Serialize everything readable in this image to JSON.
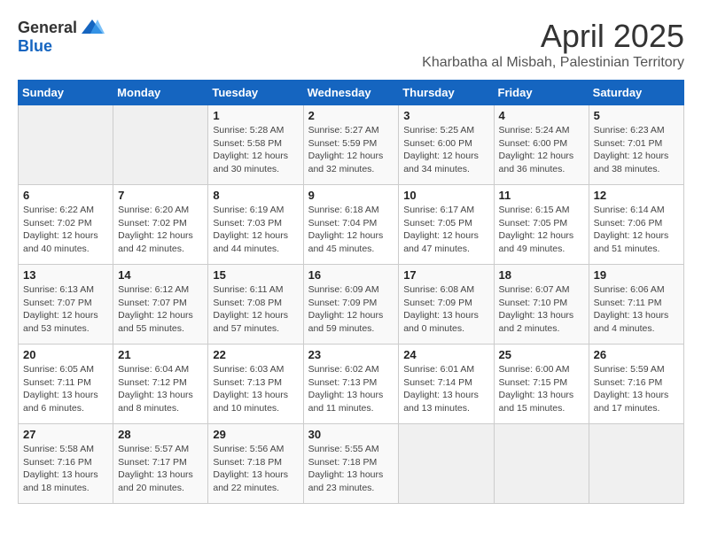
{
  "header": {
    "logo_general": "General",
    "logo_blue": "Blue",
    "month_title": "April 2025",
    "location": "Kharbatha al Misbah, Palestinian Territory"
  },
  "days_of_week": [
    "Sunday",
    "Monday",
    "Tuesday",
    "Wednesday",
    "Thursday",
    "Friday",
    "Saturday"
  ],
  "weeks": [
    [
      {
        "day": "",
        "info": ""
      },
      {
        "day": "",
        "info": ""
      },
      {
        "day": "1",
        "info": "Sunrise: 5:28 AM\nSunset: 5:58 PM\nDaylight: 12 hours\nand 30 minutes."
      },
      {
        "day": "2",
        "info": "Sunrise: 5:27 AM\nSunset: 5:59 PM\nDaylight: 12 hours\nand 32 minutes."
      },
      {
        "day": "3",
        "info": "Sunrise: 5:25 AM\nSunset: 6:00 PM\nDaylight: 12 hours\nand 34 minutes."
      },
      {
        "day": "4",
        "info": "Sunrise: 5:24 AM\nSunset: 6:00 PM\nDaylight: 12 hours\nand 36 minutes."
      },
      {
        "day": "5",
        "info": "Sunrise: 6:23 AM\nSunset: 7:01 PM\nDaylight: 12 hours\nand 38 minutes."
      }
    ],
    [
      {
        "day": "6",
        "info": "Sunrise: 6:22 AM\nSunset: 7:02 PM\nDaylight: 12 hours\nand 40 minutes."
      },
      {
        "day": "7",
        "info": "Sunrise: 6:20 AM\nSunset: 7:02 PM\nDaylight: 12 hours\nand 42 minutes."
      },
      {
        "day": "8",
        "info": "Sunrise: 6:19 AM\nSunset: 7:03 PM\nDaylight: 12 hours\nand 44 minutes."
      },
      {
        "day": "9",
        "info": "Sunrise: 6:18 AM\nSunset: 7:04 PM\nDaylight: 12 hours\nand 45 minutes."
      },
      {
        "day": "10",
        "info": "Sunrise: 6:17 AM\nSunset: 7:05 PM\nDaylight: 12 hours\nand 47 minutes."
      },
      {
        "day": "11",
        "info": "Sunrise: 6:15 AM\nSunset: 7:05 PM\nDaylight: 12 hours\nand 49 minutes."
      },
      {
        "day": "12",
        "info": "Sunrise: 6:14 AM\nSunset: 7:06 PM\nDaylight: 12 hours\nand 51 minutes."
      }
    ],
    [
      {
        "day": "13",
        "info": "Sunrise: 6:13 AM\nSunset: 7:07 PM\nDaylight: 12 hours\nand 53 minutes."
      },
      {
        "day": "14",
        "info": "Sunrise: 6:12 AM\nSunset: 7:07 PM\nDaylight: 12 hours\nand 55 minutes."
      },
      {
        "day": "15",
        "info": "Sunrise: 6:11 AM\nSunset: 7:08 PM\nDaylight: 12 hours\nand 57 minutes."
      },
      {
        "day": "16",
        "info": "Sunrise: 6:09 AM\nSunset: 7:09 PM\nDaylight: 12 hours\nand 59 minutes."
      },
      {
        "day": "17",
        "info": "Sunrise: 6:08 AM\nSunset: 7:09 PM\nDaylight: 13 hours\nand 0 minutes."
      },
      {
        "day": "18",
        "info": "Sunrise: 6:07 AM\nSunset: 7:10 PM\nDaylight: 13 hours\nand 2 minutes."
      },
      {
        "day": "19",
        "info": "Sunrise: 6:06 AM\nSunset: 7:11 PM\nDaylight: 13 hours\nand 4 minutes."
      }
    ],
    [
      {
        "day": "20",
        "info": "Sunrise: 6:05 AM\nSunset: 7:11 PM\nDaylight: 13 hours\nand 6 minutes."
      },
      {
        "day": "21",
        "info": "Sunrise: 6:04 AM\nSunset: 7:12 PM\nDaylight: 13 hours\nand 8 minutes."
      },
      {
        "day": "22",
        "info": "Sunrise: 6:03 AM\nSunset: 7:13 PM\nDaylight: 13 hours\nand 10 minutes."
      },
      {
        "day": "23",
        "info": "Sunrise: 6:02 AM\nSunset: 7:13 PM\nDaylight: 13 hours\nand 11 minutes."
      },
      {
        "day": "24",
        "info": "Sunrise: 6:01 AM\nSunset: 7:14 PM\nDaylight: 13 hours\nand 13 minutes."
      },
      {
        "day": "25",
        "info": "Sunrise: 6:00 AM\nSunset: 7:15 PM\nDaylight: 13 hours\nand 15 minutes."
      },
      {
        "day": "26",
        "info": "Sunrise: 5:59 AM\nSunset: 7:16 PM\nDaylight: 13 hours\nand 17 minutes."
      }
    ],
    [
      {
        "day": "27",
        "info": "Sunrise: 5:58 AM\nSunset: 7:16 PM\nDaylight: 13 hours\nand 18 minutes."
      },
      {
        "day": "28",
        "info": "Sunrise: 5:57 AM\nSunset: 7:17 PM\nDaylight: 13 hours\nand 20 minutes."
      },
      {
        "day": "29",
        "info": "Sunrise: 5:56 AM\nSunset: 7:18 PM\nDaylight: 13 hours\nand 22 minutes."
      },
      {
        "day": "30",
        "info": "Sunrise: 5:55 AM\nSunset: 7:18 PM\nDaylight: 13 hours\nand 23 minutes."
      },
      {
        "day": "",
        "info": ""
      },
      {
        "day": "",
        "info": ""
      },
      {
        "day": "",
        "info": ""
      }
    ]
  ]
}
